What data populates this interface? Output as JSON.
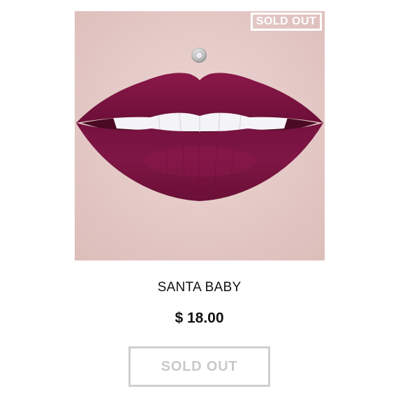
{
  "product": {
    "image_icon": "lipstick-swatch-image",
    "badge_label": "SOLD OUT",
    "name": "SANTA BABY",
    "price": "$ 18.00",
    "button_label": "SOLD OUT",
    "lip_color": "#7a1240",
    "skin_color": "#e6cdca"
  }
}
